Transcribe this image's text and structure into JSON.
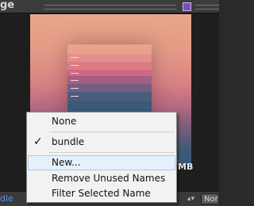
{
  "header": {
    "title": "ge"
  },
  "preview": {
    "bands": [
      {
        "color": "#e6a088"
      },
      {
        "color": "#e49088"
      },
      {
        "color": "#d97684"
      },
      {
        "color": "#c96182"
      },
      {
        "color": "#9a5f82"
      },
      {
        "color": "#6d6280"
      },
      {
        "color": "#4a5e7c"
      },
      {
        "color": "#3b5878"
      }
    ],
    "size_label": "MB"
  },
  "menu": {
    "items": [
      {
        "label": "None",
        "checked": false
      },
      {
        "label": "bundle",
        "checked": true
      },
      {
        "label": "New...",
        "checked": false
      },
      {
        "label": "Remove Unused Names",
        "checked": false
      },
      {
        "label": "Filter Selected Name",
        "checked": false
      }
    ],
    "check_glyph": "✓"
  },
  "bottom_bar": {
    "asset_bundle_label": "dle",
    "arrows": "▴▾",
    "variant_value": "Non"
  },
  "colors": {
    "accent_link": "#5b8fe8",
    "menu_highlight": "#e6f0fa",
    "menu_highlight_border": "#a9c9ec"
  }
}
